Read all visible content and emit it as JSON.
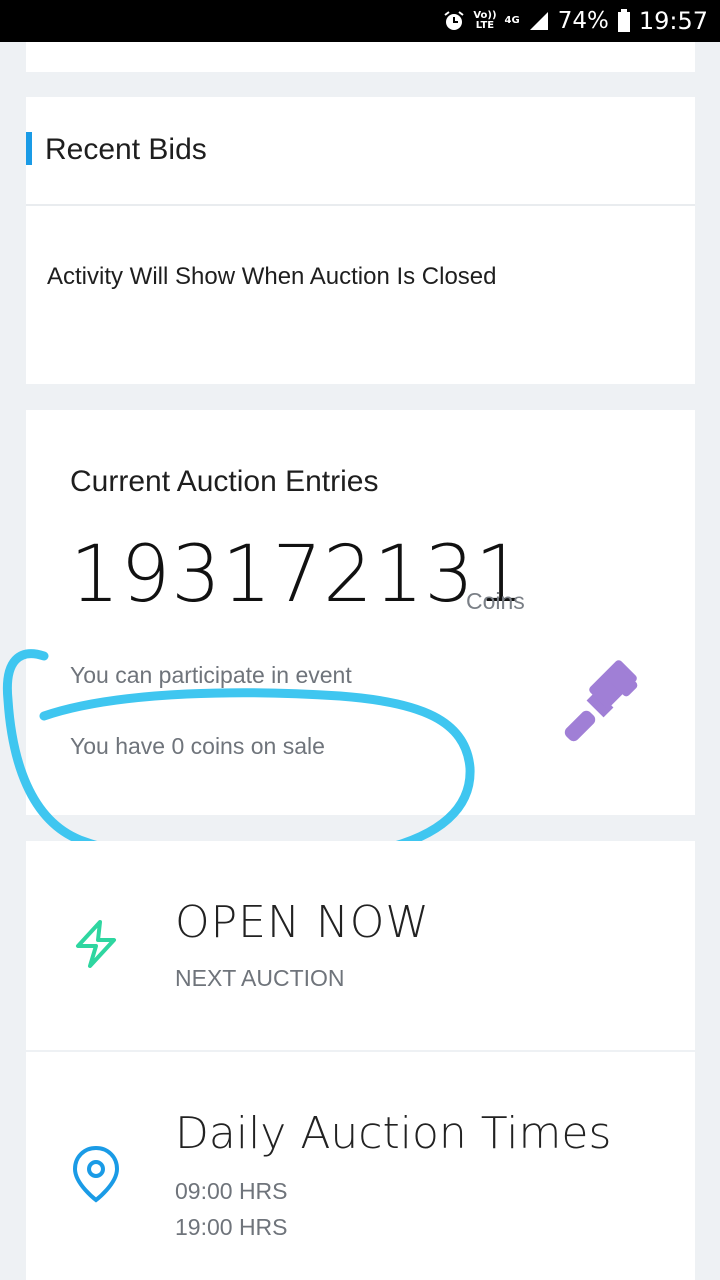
{
  "status_bar": {
    "volte_top": "Vo))",
    "volte_bottom": "LTE",
    "network": "4G",
    "battery": "74%",
    "time": "19:57",
    "icons": [
      "alarm-icon",
      "signal-icon",
      "battery-icon"
    ]
  },
  "recent_bids": {
    "title": "Recent Bids",
    "message": "Activity Will Show When Auction Is Closed",
    "accent_color": "#1a9be6"
  },
  "entries": {
    "title": "Current Auction Entries",
    "count": "193172131",
    "unit": "Coins",
    "participate_text": "You can participate in event",
    "coins_text": "You have 0 coins on sale",
    "gavel_color": "#a07fd6",
    "annotation_color": "#3fc6f0"
  },
  "next_auction": {
    "title": "OPEN NOW",
    "subtitle": "NEXT AUCTION",
    "icon_color": "#2ed6a0"
  },
  "daily_times": {
    "title": "Daily Auction Times",
    "times": [
      "09:00 HRS",
      "19:00 HRS"
    ],
    "icon_color": "#1a9be6"
  }
}
